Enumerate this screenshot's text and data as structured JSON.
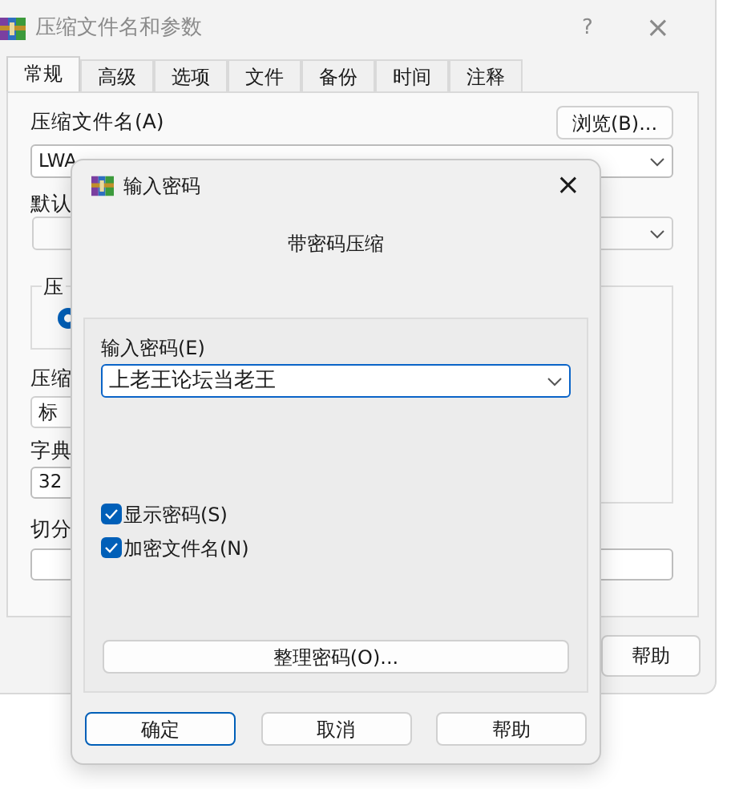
{
  "main_window": {
    "title": "压缩文件名和参数",
    "help": "?",
    "close": "×",
    "tabs": [
      {
        "label": "常规",
        "selected": true
      },
      {
        "label": "高级",
        "selected": false
      },
      {
        "label": "选项",
        "selected": false
      },
      {
        "label": "文件",
        "selected": false
      },
      {
        "label": "备份",
        "selected": false
      },
      {
        "label": "时间",
        "selected": false
      },
      {
        "label": "注释",
        "selected": false
      }
    ],
    "general": {
      "archive_label": "压缩文件名(A)",
      "browse_button": "浏览(B)...",
      "archive_value": "LWA",
      "profile_label": "默认",
      "group_legend": "压",
      "radio": {
        "selected": true
      },
      "method_label": "压缩",
      "method_value": "标",
      "dictionary_label": "字典",
      "dictionary_value": "32",
      "split_label": "切分"
    },
    "buttons": [
      "帮助"
    ]
  },
  "password_dialog": {
    "title": "输入密码",
    "close": "×",
    "heading": "带密码压缩",
    "password_label": "输入密码(E)",
    "password_value": "上老王论坛当老王",
    "options": [
      {
        "label": "显示密码(S)",
        "checked": true
      },
      {
        "label": "加密文件名(N)",
        "checked": true
      }
    ],
    "organize_button": "整理密码(O)...",
    "buttons": [
      {
        "label": "确定",
        "default": true
      },
      {
        "label": "取消",
        "default": false
      },
      {
        "label": "帮助",
        "default": false
      }
    ]
  }
}
